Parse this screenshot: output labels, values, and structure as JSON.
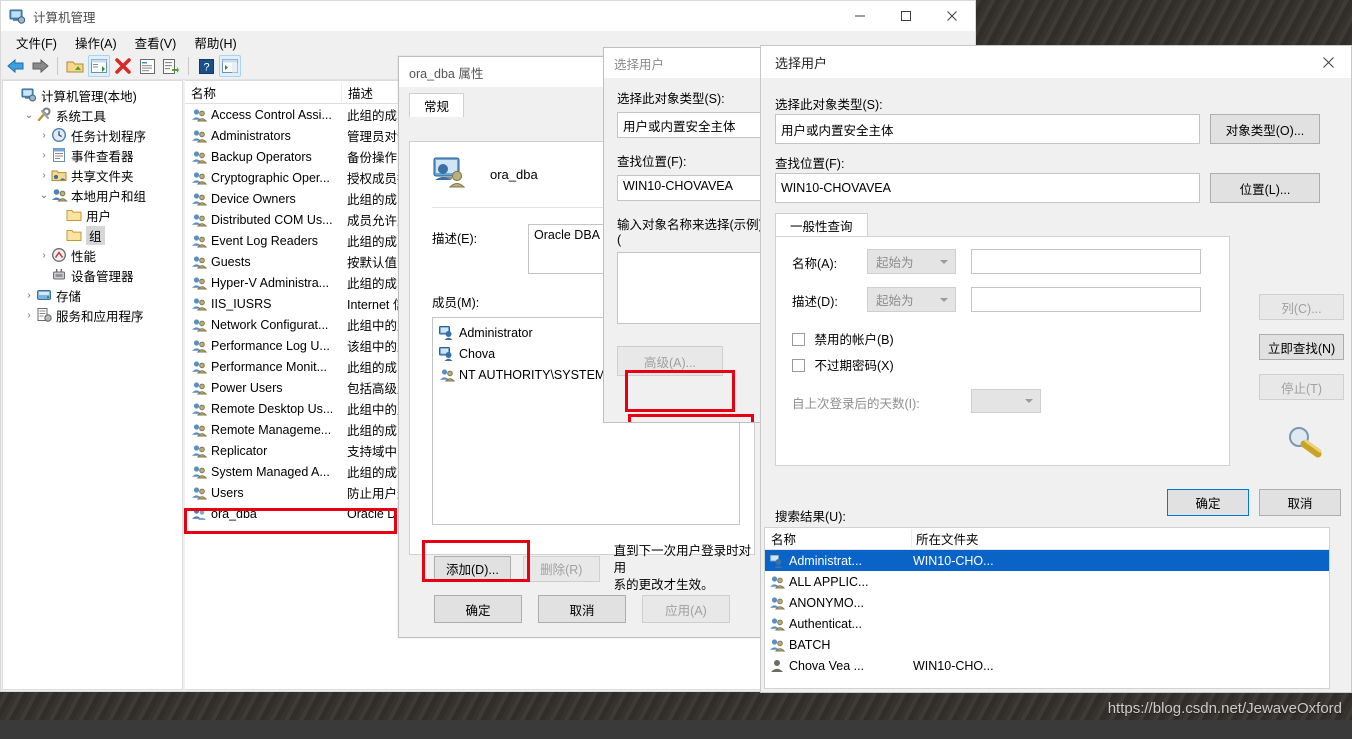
{
  "desktop": {
    "watermark": "https://blog.csdn.net/JewaveOxford"
  },
  "computer_management": {
    "title": "计算机管理",
    "caption_buttons": {
      "minimize": "minimize-icon",
      "maximize": "maximize-icon",
      "close": "close-icon"
    },
    "menus": [
      "文件(F)",
      "操作(A)",
      "查看(V)",
      "帮助(H)"
    ],
    "toolbar_icons": [
      "back-arrow-icon",
      "forward-arrow-icon",
      "folder-up-icon",
      "show-hide-tree-icon",
      "delete-red-x-icon",
      "properties-icon",
      "export-list-icon",
      "help-icon",
      "show-action-pane-icon"
    ],
    "tree": [
      {
        "label": "计算机管理(本地)",
        "indent": 0,
        "twisty": "",
        "icon": "computer-icon",
        "selected": false
      },
      {
        "label": "系统工具",
        "indent": 1,
        "twisty": "expanded",
        "icon": "tools-icon",
        "selected": false
      },
      {
        "label": "任务计划程序",
        "indent": 2,
        "twisty": "collapsed",
        "icon": "clock-icon",
        "selected": false
      },
      {
        "label": "事件查看器",
        "indent": 2,
        "twisty": "collapsed",
        "icon": "event-log-icon",
        "selected": false
      },
      {
        "label": "共享文件夹",
        "indent": 2,
        "twisty": "collapsed",
        "icon": "shared-folder-icon",
        "selected": false
      },
      {
        "label": "本地用户和组",
        "indent": 2,
        "twisty": "expanded",
        "icon": "users-groups-icon",
        "selected": false
      },
      {
        "label": "用户",
        "indent": 3,
        "twisty": "",
        "icon": "folder-icon",
        "selected": false
      },
      {
        "label": "组",
        "indent": 3,
        "twisty": "",
        "icon": "folder-icon",
        "selected": true
      },
      {
        "label": "性能",
        "indent": 2,
        "twisty": "collapsed",
        "icon": "performance-icon",
        "selected": false
      },
      {
        "label": "设备管理器",
        "indent": 2,
        "twisty": "",
        "icon": "device-manager-icon",
        "selected": false
      },
      {
        "label": "存储",
        "indent": 1,
        "twisty": "collapsed",
        "icon": "storage-icon",
        "selected": false
      },
      {
        "label": "服务和应用程序",
        "indent": 1,
        "twisty": "collapsed",
        "icon": "services-icon",
        "selected": false
      }
    ],
    "list": {
      "columns": [
        "名称",
        "描述"
      ],
      "rows": [
        {
          "name": "Access Control Assi...",
          "desc": "此组的成员"
        },
        {
          "name": "Administrators",
          "desc": "管理员对计"
        },
        {
          "name": "Backup Operators",
          "desc": "备份操作员"
        },
        {
          "name": "Cryptographic Oper...",
          "desc": "授权成员执"
        },
        {
          "name": "Device Owners",
          "desc": "此组的成员"
        },
        {
          "name": "Distributed COM Us...",
          "desc": "成员允许启"
        },
        {
          "name": "Event Log Readers",
          "desc": "此组的成员"
        },
        {
          "name": "Guests",
          "desc": "按默认值，"
        },
        {
          "name": "Hyper-V Administra...",
          "desc": "此组的成员"
        },
        {
          "name": "IIS_IUSRS",
          "desc": "Internet 信"
        },
        {
          "name": "Network Configurat...",
          "desc": "此组中的成"
        },
        {
          "name": "Performance Log U...",
          "desc": "该组中的成"
        },
        {
          "name": "Performance Monit...",
          "desc": "此组的成员"
        },
        {
          "name": "Power Users",
          "desc": "包括高级用"
        },
        {
          "name": "Remote Desktop Us...",
          "desc": "此组中的成"
        },
        {
          "name": "Remote Manageme...",
          "desc": "此组的成员"
        },
        {
          "name": "Replicator",
          "desc": "支持域中的"
        },
        {
          "name": "System Managed A...",
          "desc": "此组的成员"
        },
        {
          "name": "Users",
          "desc": "防止用户进"
        },
        {
          "name": "ora_dba",
          "desc": "Oracle D",
          "highlighted": true
        }
      ]
    }
  },
  "properties_dialog": {
    "title": "ora_dba 属性",
    "tab": "常规",
    "group_name": "ora_dba",
    "description_label": "描述(E):",
    "description_value": "Oracle DBA G",
    "members_label": "成员(M):",
    "members": [
      "Administrator",
      "Chova",
      "NT AUTHORITY\\SYSTEM (S-"
    ],
    "note": "直到下一次用户登录时对用\n系的更改才生效。",
    "add_button": "添加(D)...",
    "remove_button": "删除(R)",
    "ok_button": "确定",
    "cancel_button": "取消",
    "apply_button": "应用(A)"
  },
  "select_user_small": {
    "title": "选择用户",
    "object_type_label": "选择此对象类型(S):",
    "object_type_value": "用户或内置安全主体",
    "location_label": "查找位置(F):",
    "location_value": "WIN10-CHOVAVEA",
    "enter_names_label": "输入对象名称来选择(示例)(",
    "advanced_button": "高级(A)..."
  },
  "select_user_advanced": {
    "title": "选择用户",
    "close_icon": "close-icon",
    "object_type_label": "选择此对象类型(S):",
    "object_type_value": "用户或内置安全主体",
    "object_type_button": "对象类型(O)...",
    "location_label": "查找位置(F):",
    "location_value": "WIN10-CHOVAVEA",
    "location_button": "位置(L)...",
    "tab": "一般性查询",
    "query": {
      "name_label": "名称(A):",
      "name_operator": "起始为",
      "name_value": "",
      "desc_label": "描述(D):",
      "desc_operator": "起始为",
      "desc_value": "",
      "disabled_accounts": "禁用的帐户(B)",
      "non_expiring_password": "不过期密码(X)",
      "days_since_logon_label": "自上次登录后的天数(I):",
      "days_since_logon_value": ""
    },
    "columns_button": "列(C)...",
    "find_now_button": "立即查找(N)",
    "stop_button": "停止(T)",
    "search_icon": "search-magnifier-icon",
    "ok_button": "确定",
    "cancel_button": "取消",
    "results_label": "搜索结果(U):",
    "results_columns": [
      "名称",
      "所在文件夹"
    ],
    "results": [
      {
        "name": "Administrat...",
        "folder": "WIN10-CHO...",
        "selected": true,
        "icon": "user-icon"
      },
      {
        "name": "ALL APPLIC...",
        "folder": "",
        "selected": false,
        "icon": "group-icon"
      },
      {
        "name": "ANONYMO...",
        "folder": "",
        "selected": false,
        "icon": "group-icon"
      },
      {
        "name": "Authenticat...",
        "folder": "",
        "selected": false,
        "icon": "group-icon"
      },
      {
        "name": "BATCH",
        "folder": "",
        "selected": false,
        "icon": "group-icon"
      },
      {
        "name": "Chova Vea ...",
        "folder": "WIN10-CHO...",
        "selected": false,
        "icon": "user-icon"
      }
    ]
  },
  "annotations": {
    "highlight_color": "#e60012"
  }
}
